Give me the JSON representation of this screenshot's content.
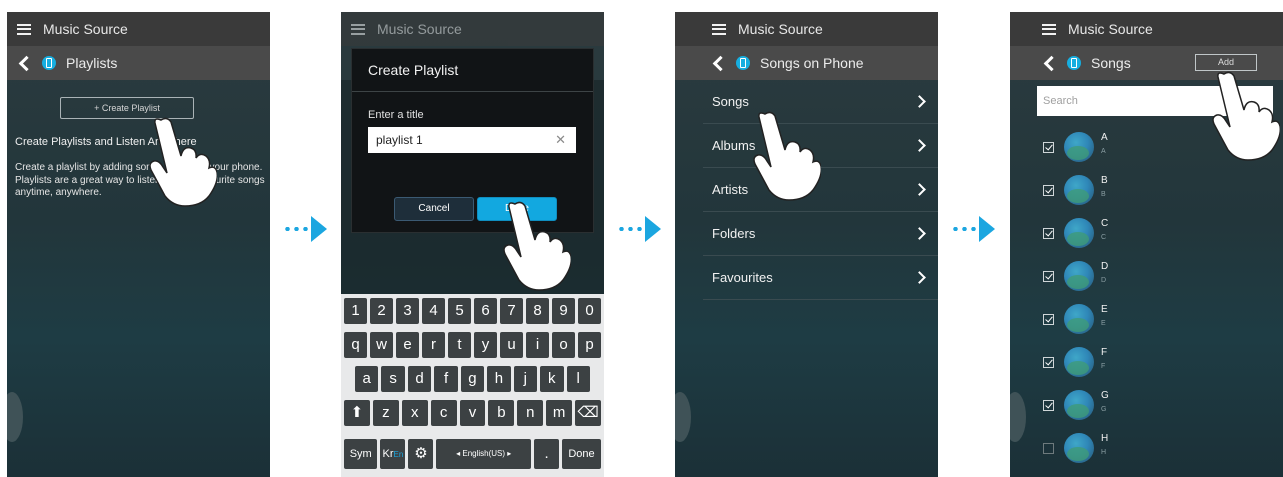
{
  "header": {
    "music_source": "Music Source"
  },
  "screen1": {
    "title": "Playlists",
    "create_button": "+ Create Playlist",
    "info_title": "Create Playlists and Listen Anywhere",
    "info_body": "Create a playlist by adding songs stored on your phone. Playlists are a great way to listen to your favourite songs anytime, anywhere."
  },
  "screen2": {
    "dialog_title": "Create Playlist",
    "label": "Enter a title",
    "input_value": "playlist 1",
    "clear": "✕",
    "cancel": "Cancel",
    "done": "Done",
    "keyboard": {
      "row1": [
        "1",
        "2",
        "3",
        "4",
        "5",
        "6",
        "7",
        "8",
        "9",
        "0"
      ],
      "row2": [
        "q",
        "w",
        "e",
        "r",
        "t",
        "y",
        "u",
        "i",
        "o",
        "p"
      ],
      "row3": [
        "a",
        "s",
        "d",
        "f",
        "g",
        "h",
        "j",
        "k",
        "l"
      ],
      "row4": [
        "⬆",
        "z",
        "x",
        "c",
        "v",
        "b",
        "n",
        "m",
        "⌫"
      ],
      "sym": "Sym",
      "lang_kr": "Kr",
      "lang_en": "En",
      "settings": "⚙",
      "space": "◂ English(US) ▸",
      "period": ".",
      "done": "Done"
    }
  },
  "screen3": {
    "title": "Songs on Phone",
    "items": [
      "Songs",
      "Albums",
      "Artists",
      "Folders",
      "Favourites"
    ]
  },
  "screen4": {
    "title": "Songs",
    "add": "Add",
    "search_placeholder": "Search",
    "songs": [
      {
        "title": "A",
        "sub": "A",
        "checked": true
      },
      {
        "title": "B",
        "sub": "B",
        "checked": true
      },
      {
        "title": "C",
        "sub": "C",
        "checked": true
      },
      {
        "title": "D",
        "sub": "D",
        "checked": true
      },
      {
        "title": "E",
        "sub": "E",
        "checked": true
      },
      {
        "title": "F",
        "sub": "F",
        "checked": true
      },
      {
        "title": "G",
        "sub": "G",
        "checked": true
      },
      {
        "title": "H",
        "sub": "H",
        "checked": false
      }
    ]
  },
  "colors": {
    "accent": "#1ba6e0",
    "arrow": "#1ba6e0",
    "done_button": "#12a8e0"
  }
}
